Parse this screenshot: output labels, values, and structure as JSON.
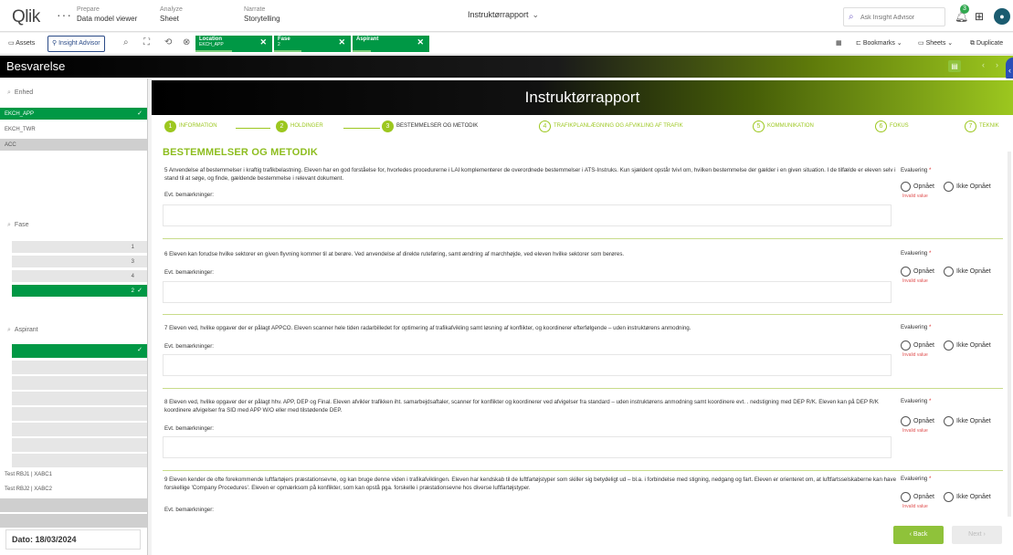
{
  "nav": {
    "logo": "Qlik",
    "menu_dots": "···",
    "prepare_small": "Prepare",
    "prepare_big": "Data model viewer",
    "analyze_small": "Analyze",
    "analyze_big": "Sheet",
    "narrate_small": "Narrate",
    "narrate_big": "Storytelling",
    "app_title": "Instruktørrapport",
    "search_placeholder": "Ask Insight Advisor",
    "notification_count": "3"
  },
  "toolbar": {
    "assets": "Assets",
    "insight_advisor": "Insight Advisor",
    "bookmarks": "Bookmarks",
    "sheets": "Sheets",
    "duplicate": "Duplicate",
    "chips": [
      {
        "title": "Location",
        "value": "EKCH_APP"
      },
      {
        "title": "Fase",
        "value": "2"
      },
      {
        "title": "Aspirant",
        "value": ""
      }
    ]
  },
  "sheet": {
    "title": "Besvarelse"
  },
  "left": {
    "enhed_label": "Enhed",
    "enhed_items": [
      "EKCH_APP",
      "EKCH_TWR",
      "ACC"
    ],
    "fase_label": "Fase",
    "fase_items": [
      "1",
      "3",
      "4",
      "2"
    ],
    "aspirant_label": "Aspirant",
    "aspirant_items": [
      "Test RBJ1 | XABC1",
      "Test RBJ2 | XABC2"
    ],
    "dato": "Dato: 18/03/2024"
  },
  "main": {
    "banner_title": "Instruktørrapport",
    "steps": [
      {
        "num": "1",
        "label": "INFORMATION"
      },
      {
        "num": "2",
        "label": "HOLDINGER"
      },
      {
        "num": "3",
        "label": "BESTEMMELSER OG METODIK"
      },
      {
        "num": "4",
        "label": "TRAFIKPLANLÆGNING OG AFVIKLING AF TRAFIK"
      },
      {
        "num": "5",
        "label": "KOMMUNIKATION"
      },
      {
        "num": "6",
        "label": "FOKUS"
      },
      {
        "num": "7",
        "label": "TEKNIK"
      }
    ],
    "section_title": "BESTEMMELSER OG METODIK",
    "eval_label": "Evaluering",
    "remark_label": "Evt. bemærkninger:",
    "opt_yes": "Opnået",
    "opt_no": "Ikke Opnået",
    "invalid": "Invalid value",
    "questions": [
      {
        "text": "5 Anvendelse af bestemmelser i kraftig trafikbelastning. Eleven har en god forståelse for, hvorledes procedurerne i LAI komplementerer de overordnede bestemmelser i ATS-Instruks. Kun sjældent opstår tvivl om, hvilken bestemmelse der gælder i en given situation. I de tilfælde er eleven selv i stand til at søge, og finde, gældende bestemmelse i relevant dokument."
      },
      {
        "text": "6 Eleven kan forudse hvilke sektorer en given flyvning kommer til at berøre. Ved anvendelse af direkte ruteføring, samt ændring af marchhøjde, ved eleven hvilke sektorer som berøres."
      },
      {
        "text": "7 Eleven ved, hvilke opgaver der er pålagt APPCO. Eleven scanner hele tiden radarbilledet for optimering af trafikafvikling samt løsning af konflikter, og koordinerer efterfølgende – uden instruktørens anmodning."
      },
      {
        "text": "8 Eleven ved, hvilke opgaver der er pålagt hhv. APP, DEP og Final. Eleven afvikler trafikken iht. samarbejdsaftaler, scanner for konflikter og koordinerer ved afvigelser fra standard – uden instruktørens anmodning samt koordinere evt. . nedstigning med DEP R/K. Eleven kan på DEP R/K koordinere afvigelser fra SID med APP W/O eller med tilstødende DEP."
      },
      {
        "text": "9 Eleven kender de ofte forekommende luftfartøjers præstationsevne, og kan bruge denne viden i trafikafviklingen. Eleven har kendskab til de luftfartøjstyper som skiller sig betydeligt ud – bl.a. i forbindelse med stigning, nedgang og fart. Eleven er orienteret om, at luftfartsselskaberne kan have forskellige 'Company Procedures'. Eleven er opmærksom på konflikter, som kan opstå pga. forskelle i præstationsevne hos diverse luftfartøjstyper."
      }
    ],
    "back_label": "Back",
    "next_label": "Next"
  }
}
